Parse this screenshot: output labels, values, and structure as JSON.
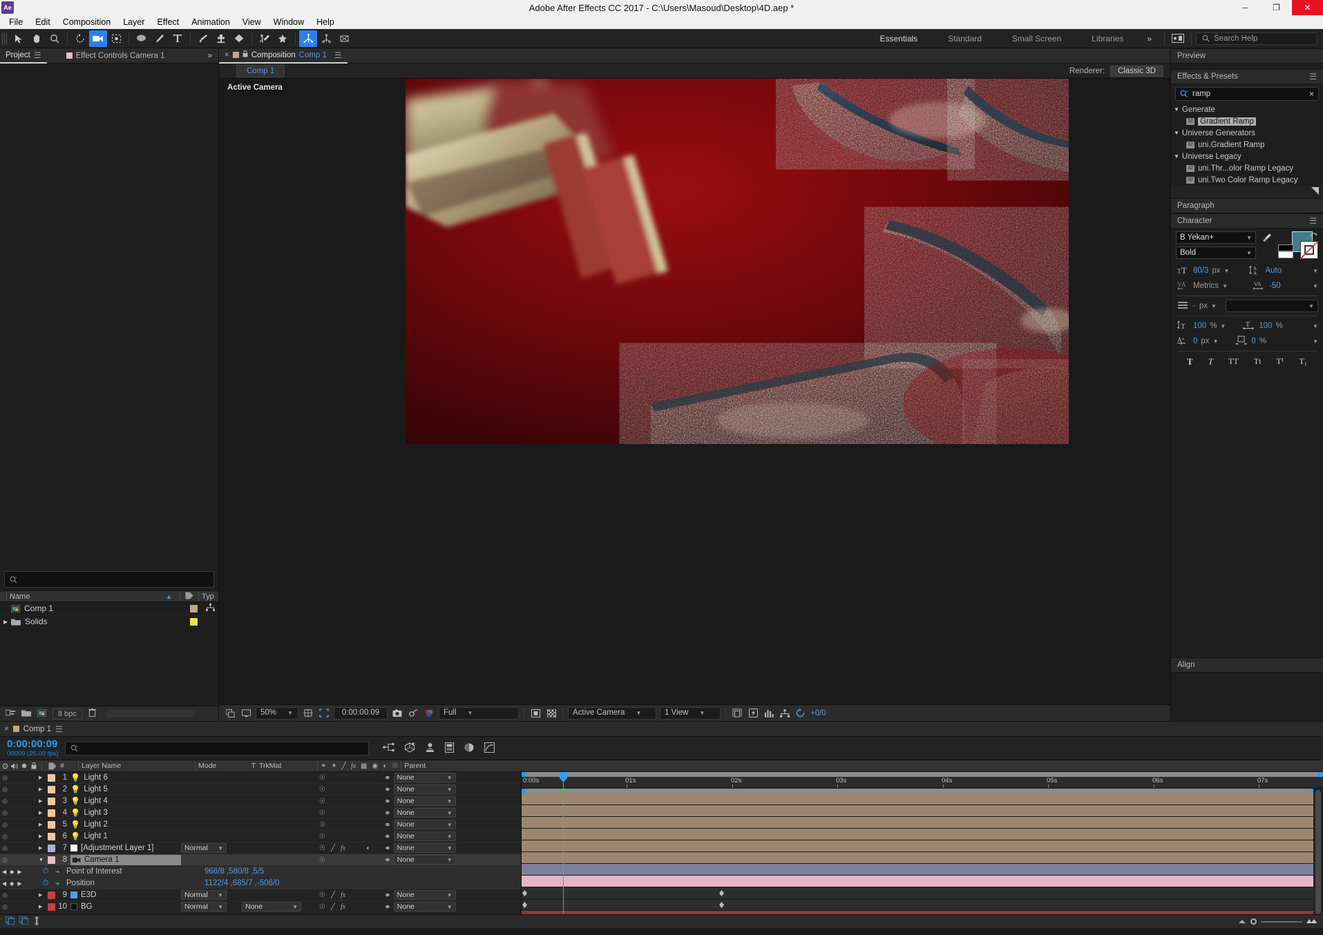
{
  "titlebar": {
    "app_icon": "ae-icon",
    "title": "Adobe After Effects CC 2017 - C:\\Users\\Masoud\\Desktop\\4D.aep *",
    "minimize": "─",
    "maximize": "❐",
    "close": "✕"
  },
  "menubar": {
    "items": [
      "File",
      "Edit",
      "Composition",
      "Layer",
      "Effect",
      "Animation",
      "View",
      "Window",
      "Help"
    ]
  },
  "toolbar": {
    "tools": [
      {
        "name": "selection-tool",
        "glyph": "➤",
        "selected": false
      },
      {
        "name": "hand-tool",
        "glyph": "✋",
        "selected": false
      },
      {
        "name": "zoom-tool",
        "glyph": "⌕",
        "selected": false
      },
      {
        "name": "rotation-tool",
        "glyph": "↺",
        "selected": false
      },
      {
        "name": "camera-tool",
        "glyph": "🎥",
        "selected": true
      },
      {
        "name": "pan-behind-tool",
        "glyph": "⬚",
        "selected": false
      },
      {
        "name": "shape-tool",
        "glyph": "●",
        "selected": false
      },
      {
        "name": "pen-tool",
        "glyph": "✒",
        "selected": false
      },
      {
        "name": "type-tool",
        "glyph": "T",
        "selected": false
      },
      {
        "name": "brush-tool",
        "glyph": "╱",
        "selected": false
      },
      {
        "name": "clone-stamp-tool",
        "glyph": "⚓",
        "selected": false
      },
      {
        "name": "eraser-tool",
        "glyph": "◆",
        "selected": false
      },
      {
        "name": "roto-brush-tool",
        "glyph": "⚘",
        "selected": false
      },
      {
        "name": "puppet-pin-tool",
        "glyph": "✦",
        "selected": false
      }
    ],
    "axis_tools": [
      {
        "name": "local-axis-mode-icon",
        "glyph": "✶",
        "selected": true
      },
      {
        "name": "world-axis-mode-icon",
        "glyph": "✵",
        "selected": false
      },
      {
        "name": "view-axis-mode-icon",
        "glyph": "⬠",
        "selected": false
      }
    ]
  },
  "workspaces": {
    "items": [
      "Essentials",
      "Standard",
      "Small Screen",
      "Libraries"
    ],
    "active": "Essentials",
    "overflow": "»",
    "edit_workspace_icon": "workspace-edit-icon"
  },
  "search_help": {
    "placeholder": "Search Help",
    "icon": "search-icon"
  },
  "project_panel": {
    "tabs": [
      {
        "label": "Project",
        "active": true,
        "swatch": "",
        "name": "tab-project"
      },
      {
        "label": "Effect Controls Camera 1",
        "active": false,
        "swatch": "#e8bcc8",
        "name": "tab-effect-controls"
      }
    ],
    "overflow": "»",
    "search_placeholder": "",
    "columns": [
      "Name",
      "",
      "Typ"
    ],
    "sort_indicator": "▲",
    "items": [
      {
        "name": "Comp 1",
        "icon": "composition-icon",
        "swatch": "#c3a884",
        "type_icon": "comp-tree-icon",
        "indent": 14,
        "expand": ""
      },
      {
        "name": "Solids",
        "icon": "folder-icon",
        "swatch": "#e8e840",
        "type_icon": "",
        "indent": 0,
        "expand": "▶"
      }
    ],
    "footer": {
      "bit_depth": "8 bpc",
      "icons": [
        "interpret-footage-icon",
        "new-folder-icon",
        "new-composition-icon",
        "delete-icon"
      ]
    }
  },
  "composition_panel": {
    "tab_close": "×",
    "tab_swatch": "#c3a884",
    "lock_icon": "lock-icon",
    "tab_prefix": "Composition",
    "tab_name": "Comp 1",
    "menu_icon": "panel-menu-icon",
    "chip_label": "Comp 1",
    "renderer_label": "Renderer:",
    "renderer_value": "Classic 3D",
    "active_camera_label": "Active Camera",
    "bottom_bar": {
      "magnification": "50%",
      "current_time": "0:00:00:09",
      "resolution": "Full",
      "view_camera": "Active Camera",
      "view_layout": "1 View",
      "frame_counter": "+0/0",
      "icons": [
        "always-preview-icon",
        "toggle-viewer-icon",
        "region-of-interest-icon",
        "transparency-grid-icon",
        "take-snapshot-icon",
        "show-snapshot-icon",
        "channel-icon",
        "toggle-mask-icon",
        "toggle-alpha-icon",
        "timeline-3dview-icon",
        "fast-preview-icon",
        "histogram-icon",
        "comp-flowchart-icon",
        "reset-exposure-icon"
      ]
    }
  },
  "preview_panel": {
    "title": "Preview"
  },
  "effects_presets": {
    "title": "Effects & Presets",
    "menu_icon": "panel-menu-icon",
    "search_value": "ramp",
    "search_icon": "search-icon",
    "clear_icon": "×",
    "groups": [
      {
        "name": "Generate",
        "expanded": true,
        "items": [
          {
            "label": "Gradient Ramp",
            "selected": true,
            "badge": "32"
          }
        ]
      },
      {
        "name": "Universe Generators",
        "expanded": true,
        "items": [
          {
            "label": "uni.Gradient Ramp",
            "selected": false,
            "badge": "32"
          }
        ]
      },
      {
        "name": "Universe Legacy",
        "expanded": true,
        "items": [
          {
            "label": "uni.Thr...olor Ramp Legacy",
            "selected": false,
            "badge": "32"
          },
          {
            "label": "uni.Two Color Ramp Legacy",
            "selected": false,
            "badge": "32"
          }
        ]
      }
    ]
  },
  "paragraph_panel": {
    "title": "Paragraph"
  },
  "character_panel": {
    "title": "Character",
    "menu_icon": "panel-menu-icon",
    "font_family": "B Yekan+",
    "font_style": "Bold",
    "fill_color": "#3f7f8c",
    "stroke_color": "#ffffff",
    "eyedropper_icon": "eyedropper-icon",
    "font_size": "80/3",
    "font_size_unit": "px",
    "leading": "Auto",
    "kerning": "Metrics",
    "tracking": "-50",
    "stroke_width": "-",
    "stroke_width_unit": "px",
    "vertical_scale": "100",
    "vertical_scale_unit": "%",
    "horizontal_scale": "100",
    "horizontal_scale_unit": "%",
    "baseline_shift": "0",
    "baseline_shift_unit": "px",
    "tsume": "0",
    "tsume_unit": "%",
    "style_buttons": [
      "T",
      "T",
      "TT",
      "Tt",
      "T¹",
      "T₁"
    ],
    "icons": {
      "font_size": "font-size-icon",
      "leading": "leading-icon",
      "kerning": "kerning-icon",
      "tracking": "tracking-icon",
      "stroke": "stroke-width-icon",
      "vscale": "vertical-scale-icon",
      "hscale": "horizontal-scale-icon",
      "baseline": "baseline-shift-icon",
      "tsume": "tsume-icon"
    }
  },
  "align_panel": {
    "title": "Align"
  },
  "timeline": {
    "tab_close": "×",
    "tab_swatch": "#c3a884",
    "tab_name": "Comp 1",
    "menu_icon": "panel-menu-icon",
    "current_time": "0:00:00:09",
    "frame_info": "00009 (25.00 fps)",
    "search_placeholder": "",
    "toolbar_icons": [
      "composition-mini-flowchart-icon",
      "draft-3d-icon",
      "hide-shy-layers-icon",
      "frame-blending-icon",
      "motion-blur-icon",
      "graph-editor-icon"
    ],
    "columns": [
      {
        "label": "",
        "name": "col-video-eye"
      },
      {
        "label": "",
        "name": "col-audio"
      },
      {
        "label": "",
        "name": "col-solo"
      },
      {
        "label": "",
        "name": "col-lock"
      },
      {
        "label": "",
        "name": "col-label"
      },
      {
        "label": "#",
        "name": "col-index"
      },
      {
        "label": "Layer Name",
        "name": "col-layer-name"
      },
      {
        "label": "Mode",
        "name": "col-mode"
      },
      {
        "label": "T",
        "name": "col-preserve-transparency"
      },
      {
        "label": "TrkMat",
        "name": "col-track-matte"
      },
      {
        "label": "Parent",
        "name": "col-parent"
      }
    ],
    "switch_icons": [
      "shy-icon",
      "collapse-icon",
      "quality-icon",
      "fx-icon",
      "frame-blend-icon",
      "motion-blur-icon",
      "adjustment-icon",
      "3d-layer-icon"
    ],
    "layers": [
      {
        "index": "1",
        "name": "Light 6",
        "type": "light",
        "label_color": "#f0c8a0",
        "bar_color": "#9d8670",
        "mode": "",
        "trkmat": "",
        "parent": "None",
        "selected": false,
        "expanded": false
      },
      {
        "index": "2",
        "name": "Light 5",
        "type": "light",
        "label_color": "#f0c8a0",
        "bar_color": "#9d8670",
        "mode": "",
        "trkmat": "",
        "parent": "None",
        "selected": false,
        "expanded": false
      },
      {
        "index": "3",
        "name": "Light 4",
        "type": "light",
        "label_color": "#f0c8a0",
        "bar_color": "#9d8670",
        "mode": "",
        "trkmat": "",
        "parent": "None",
        "selected": false,
        "expanded": false
      },
      {
        "index": "4",
        "name": "Light 3",
        "type": "light",
        "label_color": "#f0c8a0",
        "bar_color": "#9d8670",
        "mode": "",
        "trkmat": "",
        "parent": "None",
        "selected": false,
        "expanded": false
      },
      {
        "index": "5",
        "name": "Light 2",
        "type": "light",
        "label_color": "#f0c8a0",
        "bar_color": "#9d8670",
        "mode": "",
        "trkmat": "",
        "parent": "None",
        "selected": false,
        "expanded": false
      },
      {
        "index": "6",
        "name": "Light 1",
        "type": "light",
        "label_color": "#f0c8a0",
        "bar_color": "#9d8670",
        "mode": "",
        "trkmat": "",
        "parent": "None",
        "selected": false,
        "expanded": false
      },
      {
        "index": "7",
        "name": "[Adjustment Layer 1]",
        "type": "adjustment",
        "label_color": "#b0aed0",
        "bar_color": "#7d7f9c",
        "mode": "Normal",
        "trkmat": "",
        "parent": "None",
        "selected": false,
        "expanded": false
      },
      {
        "index": "8",
        "name": "Camera 1",
        "type": "camera",
        "label_color": "#e8bcc8",
        "bar_color": "#e3b6c6",
        "mode": "",
        "trkmat": "",
        "parent": "None",
        "selected": true,
        "expanded": true
      },
      {
        "index": "9",
        "name": "E3D",
        "type": "solid",
        "label_color": "#c84040",
        "bar_color": "#8a3c3c",
        "mode": "Normal",
        "trkmat": "",
        "parent": "None",
        "selected": false,
        "expanded": false
      },
      {
        "index": "10",
        "name": "BG",
        "type": "solid",
        "label_color": "#c84040",
        "bar_color": "#8a3c3c",
        "mode": "Normal",
        "trkmat": "None",
        "parent": "None",
        "selected": false,
        "expanded": false
      }
    ],
    "properties": [
      {
        "name": "Point of Interest",
        "value": "966/8 ,580/8 ,5/5",
        "keyframes": [
          0,
          0.195
        ]
      },
      {
        "name": "Position",
        "value": "1122/4 ,685/7 ,-506/0",
        "keyframes": [
          0,
          0.195
        ]
      }
    ],
    "ruler": {
      "ticks": [
        "0:00s",
        "01s",
        "02s",
        "03s",
        "04s",
        "05s",
        "06s",
        "07s"
      ],
      "start_label": "0:00s"
    },
    "footer_icons": [
      "toggle-switches-modes-icon",
      "toggle-switches-icon",
      "graph-icon"
    ],
    "zoom": {
      "out_icon": "zoom-out-icon",
      "in_icon": "zoom-in-icon"
    }
  }
}
